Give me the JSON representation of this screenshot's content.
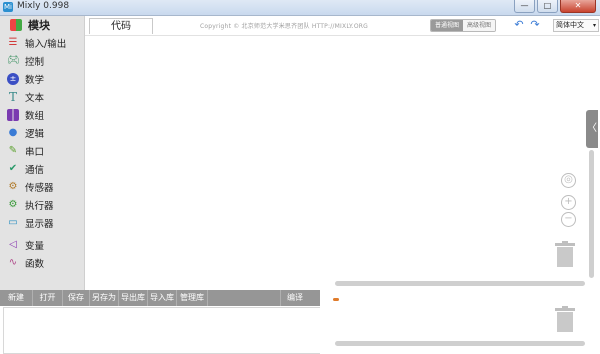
{
  "window": {
    "title": "Mixly 0.998",
    "app_icon": "Mi",
    "minimize": "—",
    "maximize": "□",
    "close": "✕"
  },
  "sidebar": {
    "header": "模块",
    "items": [
      {
        "label": "输入/输出",
        "icon": "input-output-icon",
        "color": "#d23b3b"
      },
      {
        "label": "控制",
        "icon": "gamepad-icon",
        "color": "#2e8b57"
      },
      {
        "label": "数学",
        "icon": "math-icon",
        "color": "#3b4fc4"
      },
      {
        "label": "文本",
        "icon": "text-icon",
        "color": "#3a8a8a"
      },
      {
        "label": "数组",
        "icon": "array-icon",
        "color": "#7a3bb0"
      },
      {
        "label": "逻辑",
        "icon": "logic-icon",
        "color": "#3a7bd5"
      },
      {
        "label": "串口",
        "icon": "serial-icon",
        "color": "#5aa02c"
      },
      {
        "label": "通信",
        "icon": "communication-icon",
        "color": "#2a9a6a"
      },
      {
        "label": "传感器",
        "icon": "sensor-icon",
        "color": "#b07a2a"
      },
      {
        "label": "执行器",
        "icon": "actuator-icon",
        "color": "#3a9a3a"
      },
      {
        "label": "显示器",
        "icon": "display-icon",
        "color": "#2a8fc0"
      },
      {
        "label": "变量",
        "icon": "variable-icon",
        "color": "#8a3ab0"
      },
      {
        "label": "函数",
        "icon": "function-icon",
        "color": "#b04a8a"
      }
    ]
  },
  "topbar": {
    "code_tab": "代码",
    "copyright": "Copyright © 北京师范大学米思齐团队 HTTP://MIXLY.ORG",
    "view_normal": "普通视图",
    "view_advanced": "高级视图",
    "language": "简体中文",
    "language_arrow": "▾",
    "undo_glyph": "↶",
    "redo_glyph": "↷"
  },
  "toolbar": {
    "new": "新建",
    "open": "打开",
    "save": "保存",
    "save_as": "另存为",
    "export_lib": "导出库",
    "import_lib": "导入库",
    "manage_lib": "管理库",
    "compile": "编译"
  },
  "workspace": {
    "collapse_glyph": "〈",
    "center_glyph": "◎",
    "zoom_in_glyph": "+",
    "zoom_out_glyph": "−"
  }
}
